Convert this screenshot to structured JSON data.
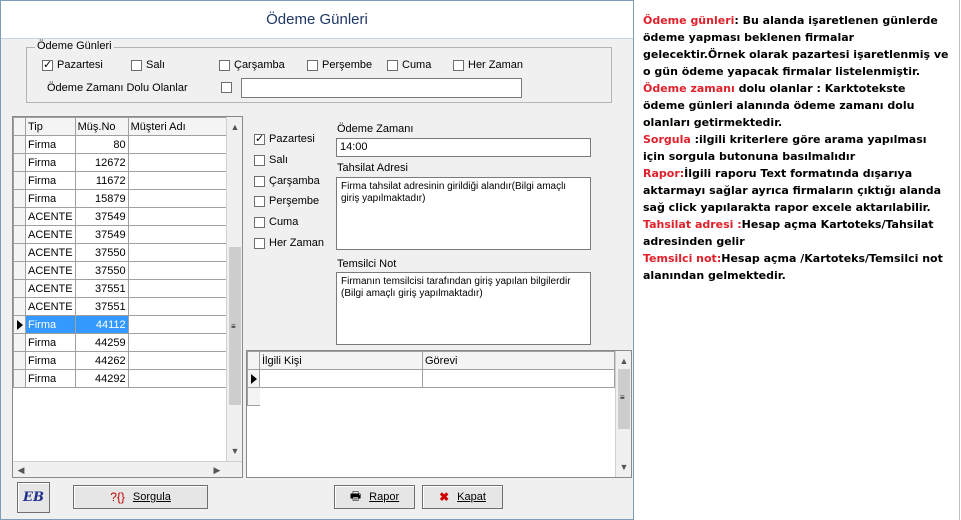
{
  "window": {
    "title": "Ödeme Günleri"
  },
  "filter_group": {
    "legend": "Ödeme Günleri",
    "days": [
      {
        "label": "Pazartesi",
        "checked": true
      },
      {
        "label": "Salı",
        "checked": false
      },
      {
        "label": "Çarşamba",
        "checked": false
      },
      {
        "label": "Perşembe",
        "checked": false
      },
      {
        "label": "Cuma",
        "checked": false
      },
      {
        "label": "Her Zaman",
        "checked": false
      }
    ],
    "filled_label": "Ödeme Zamanı Dolu Olanlar",
    "filled_checked": false,
    "filled_value": ""
  },
  "firm_grid": {
    "columns": [
      "Tip",
      "Müş.No",
      "Müşteri Adı"
    ],
    "rows": [
      {
        "tip": "Firma",
        "no": "80",
        "name": ""
      },
      {
        "tip": "Firma",
        "no": "12672",
        "name": ""
      },
      {
        "tip": "Firma",
        "no": "11672",
        "name": ""
      },
      {
        "tip": "Firma",
        "no": "15879",
        "name": ""
      },
      {
        "tip": "ACENTE",
        "no": "37549",
        "name": ""
      },
      {
        "tip": "ACENTE",
        "no": "37549",
        "name": ""
      },
      {
        "tip": "ACENTE",
        "no": "37550",
        "name": ""
      },
      {
        "tip": "ACENTE",
        "no": "37550",
        "name": ""
      },
      {
        "tip": "ACENTE",
        "no": "37551",
        "name": ""
      },
      {
        "tip": "ACENTE",
        "no": "37551",
        "name": ""
      },
      {
        "tip": "Firma",
        "no": "44112",
        "name": "",
        "selected": true
      },
      {
        "tip": "Firma",
        "no": "44259",
        "name": ""
      },
      {
        "tip": "Firma",
        "no": "44262",
        "name": ""
      },
      {
        "tip": "Firma",
        "no": "44292",
        "name": ""
      }
    ]
  },
  "detail": {
    "days": [
      {
        "label": "Pazartesi",
        "checked": true
      },
      {
        "label": "Salı",
        "checked": false
      },
      {
        "label": "Çarşamba",
        "checked": false
      },
      {
        "label": "Perşembe",
        "checked": false
      },
      {
        "label": "Cuma",
        "checked": false
      },
      {
        "label": "Her Zaman",
        "checked": false
      }
    ],
    "time_label": "Ödeme Zamanı",
    "time_value": "14:00",
    "address_label": "Tahsilat Adresi",
    "address_value": "Firma tahsilat adresinin girildiği alandır(Bilgi amaçlı giriş yapılmaktadır)",
    "note_label": "Temsilci Not",
    "note_value": "Firmanın temsilcisi tarafından giriş yapılan bilgilerdir (Bilgi amaçlı giriş yapılmaktadır)"
  },
  "contact_grid": {
    "columns": [
      "İlgili Kişi",
      "Görevi"
    ]
  },
  "buttons": {
    "logo": "EB",
    "query": "Sorgula",
    "report": "Rapor",
    "close": "Kapat"
  },
  "help": [
    {
      "key": "Ödeme günleri",
      "text": ": Bu alanda işaretlenen günlerde ödeme yapması beklenen firmalar gelecektir.Örnek olarak pazartesi işaretlenmiş ve o gün ödeme yapacak firmalar listelenmiştir."
    },
    {
      "key": "Ödeme zamanı",
      "text": " dolu olanlar : Karktotekste ödeme günleri alanında ödeme zamanı dolu olanları getirmektedir."
    },
    {
      "key": "Sorgula",
      "text": " :ilgili kriterlere göre arama yapılması için sorgula butonuna basılmalıdır"
    },
    {
      "key": "Rapor:",
      "text": "İlgili raporu Text formatında dışarıya aktarmayı sağlar ayrıca firmaların çıktığı alanda sağ click yapılarakta rapor excele aktarılabilir."
    },
    {
      "key": "Tahsilat adresi :",
      "text": "Hesap açma   Kartoteks/Tahsilat adresinden gelir"
    },
    {
      "key": "Temsilci not:",
      "text": "Hesap açma /Kartoteks/Temsilci not alanından gelmektedir."
    }
  ]
}
